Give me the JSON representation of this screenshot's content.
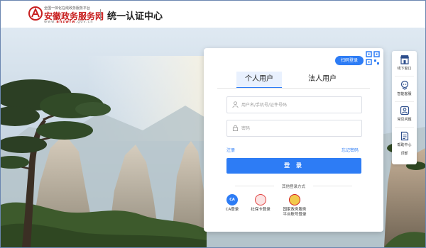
{
  "header": {
    "tagline": "全国一体化在线政务服务平台",
    "site_name": "安徽政务服务网",
    "url_prefix": "www.",
    "url_domain": "ahzwfw",
    "url_suffix": ".gov.cn",
    "page_title": "统一认证中心"
  },
  "login": {
    "qr_label": "扫码登录",
    "tabs": [
      "个人用户",
      "法人用户"
    ],
    "username_placeholder": "用户名/手机号/证件号码",
    "password_placeholder": "密码",
    "register_label": "注册",
    "forgot_label": "忘记密码",
    "login_button": "登 录",
    "other_methods_label": "其他登录方式",
    "methods": [
      {
        "icon_text": "CA",
        "label": "CA登录"
      },
      {
        "label": "社保卡登录"
      },
      {
        "label_line1": "国家政务服务",
        "label_line2": "平台账号登录"
      }
    ]
  },
  "dock": {
    "items": [
      {
        "label": "线下窗口",
        "icon": "store-icon"
      },
      {
        "label": "智能客服",
        "icon": "chat-bot-icon"
      },
      {
        "label": "常见问题",
        "icon": "question-icon"
      },
      {
        "label": "帮助中心",
        "icon": "help-doc-icon"
      }
    ],
    "top_label": "顶部"
  },
  "colors": {
    "brand_red": "#c81f1f",
    "primary_blue": "#2d7cf5"
  }
}
